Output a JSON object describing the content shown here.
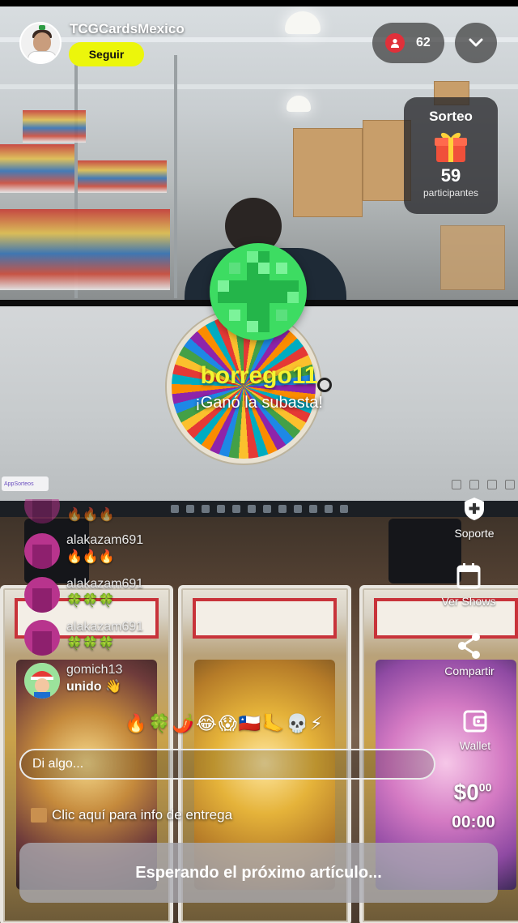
{
  "host": {
    "name": "TCGCardsMexico",
    "follow_label": "Seguir"
  },
  "viewers": {
    "count": "62"
  },
  "raffle": {
    "title": "Sorteo",
    "count": "59",
    "subtitle": "participantes"
  },
  "winner": {
    "name": "borrego11",
    "message": "¡Ganó la subasta!"
  },
  "overlay_logo": "AppSorteos",
  "chat": [
    {
      "user": "alakazam691",
      "message": "🔥🔥🔥"
    },
    {
      "user": "alakazam691",
      "message": "🍀🍀🍀"
    },
    {
      "user": "alakazam691",
      "message": "🍀🍀🍀"
    },
    {
      "user": "gomich13",
      "message": "unido 👋"
    }
  ],
  "chat_faded_top": {
    "message": "🔥🔥🔥"
  },
  "quick_reactions": "🔥🍀🌶️😂😱🇨🇱🦶💀⚡",
  "input": {
    "placeholder": "Di algo..."
  },
  "delivery_link": "Clic aquí para info de entrega",
  "waiting_label": "Esperando el próximo artículo...",
  "rail": {
    "support": "Soporte",
    "shows": "Ver Shows",
    "share": "Compartir",
    "wallet": "Wallet"
  },
  "price": {
    "main": "$0",
    "cents": "00"
  },
  "timer": "00:00",
  "colors": {
    "follow_button": "#ecf60b",
    "winner_name": "#f3f532",
    "viewer_dot": "#e0303a",
    "badge_green": "#3ddc62"
  }
}
